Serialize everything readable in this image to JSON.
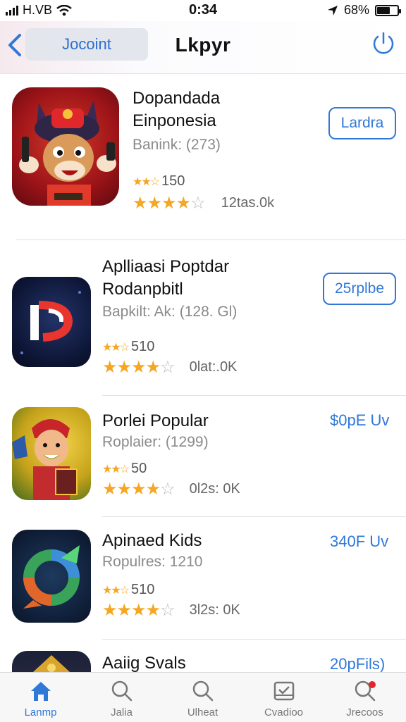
{
  "status": {
    "carrier": "H.VB",
    "time": "0:34",
    "battery": "68%"
  },
  "nav": {
    "back_label": "Jocoint",
    "title": "Lkpyr"
  },
  "apps": [
    {
      "name_line1": "Dopandada",
      "name_line2": "Einponesia",
      "subtitle": "Banink: (273)",
      "rating": "150",
      "reviews": "12tas.0k",
      "action": "Lardra"
    },
    {
      "name_line1": "Aplliaasi Poptdar",
      "name_line2": "Rodanpbitl",
      "subtitle": "Bapkilt: Ak: (128. Gl)",
      "rating": "510",
      "reviews": "0lat:.0K",
      "action": "25rplbe"
    },
    {
      "name_line1": "Porlei Popular",
      "subtitle": "Roplaier: (1299)",
      "rating": "50",
      "reviews": "0l2s: 0K",
      "action": "$0pE Uv"
    },
    {
      "name_line1": "Apinaed Kids",
      "subtitle": "Ropulres: 1210",
      "rating": "510",
      "reviews": "3l2s: 0K",
      "action": "340F Uv"
    },
    {
      "name_line1": "Aaiig Svals",
      "action": "20pFils)"
    }
  ],
  "tabs": [
    {
      "label": "Lanmp",
      "icon": "home-icon"
    },
    {
      "label": "Jalia",
      "icon": "search-icon"
    },
    {
      "label": "Ulheat",
      "icon": "search-icon"
    },
    {
      "label": "Cvadioo",
      "icon": "inbox-icon"
    },
    {
      "label": "Jrecoos",
      "icon": "search-badge-icon"
    }
  ],
  "colors": {
    "accent": "#2f78d8",
    "star": "#f5a623"
  }
}
